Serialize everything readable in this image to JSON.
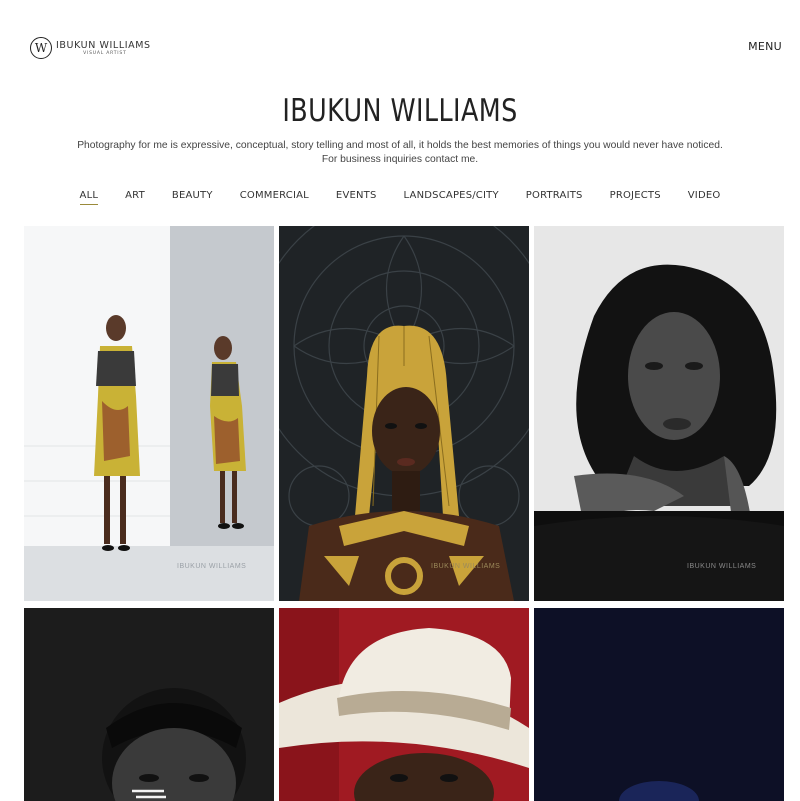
{
  "header": {
    "logo_name": "IBUKUN WILLIAMS",
    "logo_sub": "VISUAL ARTIST",
    "menu_label": "MENU"
  },
  "title": "IBUKUN WILLIAMS",
  "intro": {
    "line1": "Photography for me is expressive, conceptual, story telling and most of all, it holds the best memories of things you would never have noticed.",
    "line2": "For business inquiries contact me."
  },
  "filters": [
    {
      "label": "ALL",
      "active": true
    },
    {
      "label": "ART"
    },
    {
      "label": "BEAUTY"
    },
    {
      "label": "COMMERCIAL"
    },
    {
      "label": "EVENTS"
    },
    {
      "label": "LANDSCAPES/CITY"
    },
    {
      "label": "PORTRAITS"
    },
    {
      "label": "PROJECTS"
    },
    {
      "label": "VIDEO"
    }
  ],
  "gallery": {
    "watermark": "IBUKUN WILLIAMS",
    "colors": {
      "accent_underline": "#9a8a3a",
      "studio_gray": "#c9ccd0",
      "dark_pattern": "#1f2326",
      "gold": "#c9a33a",
      "red_backdrop": "#a01a22",
      "navy": "#0d1026"
    }
  }
}
